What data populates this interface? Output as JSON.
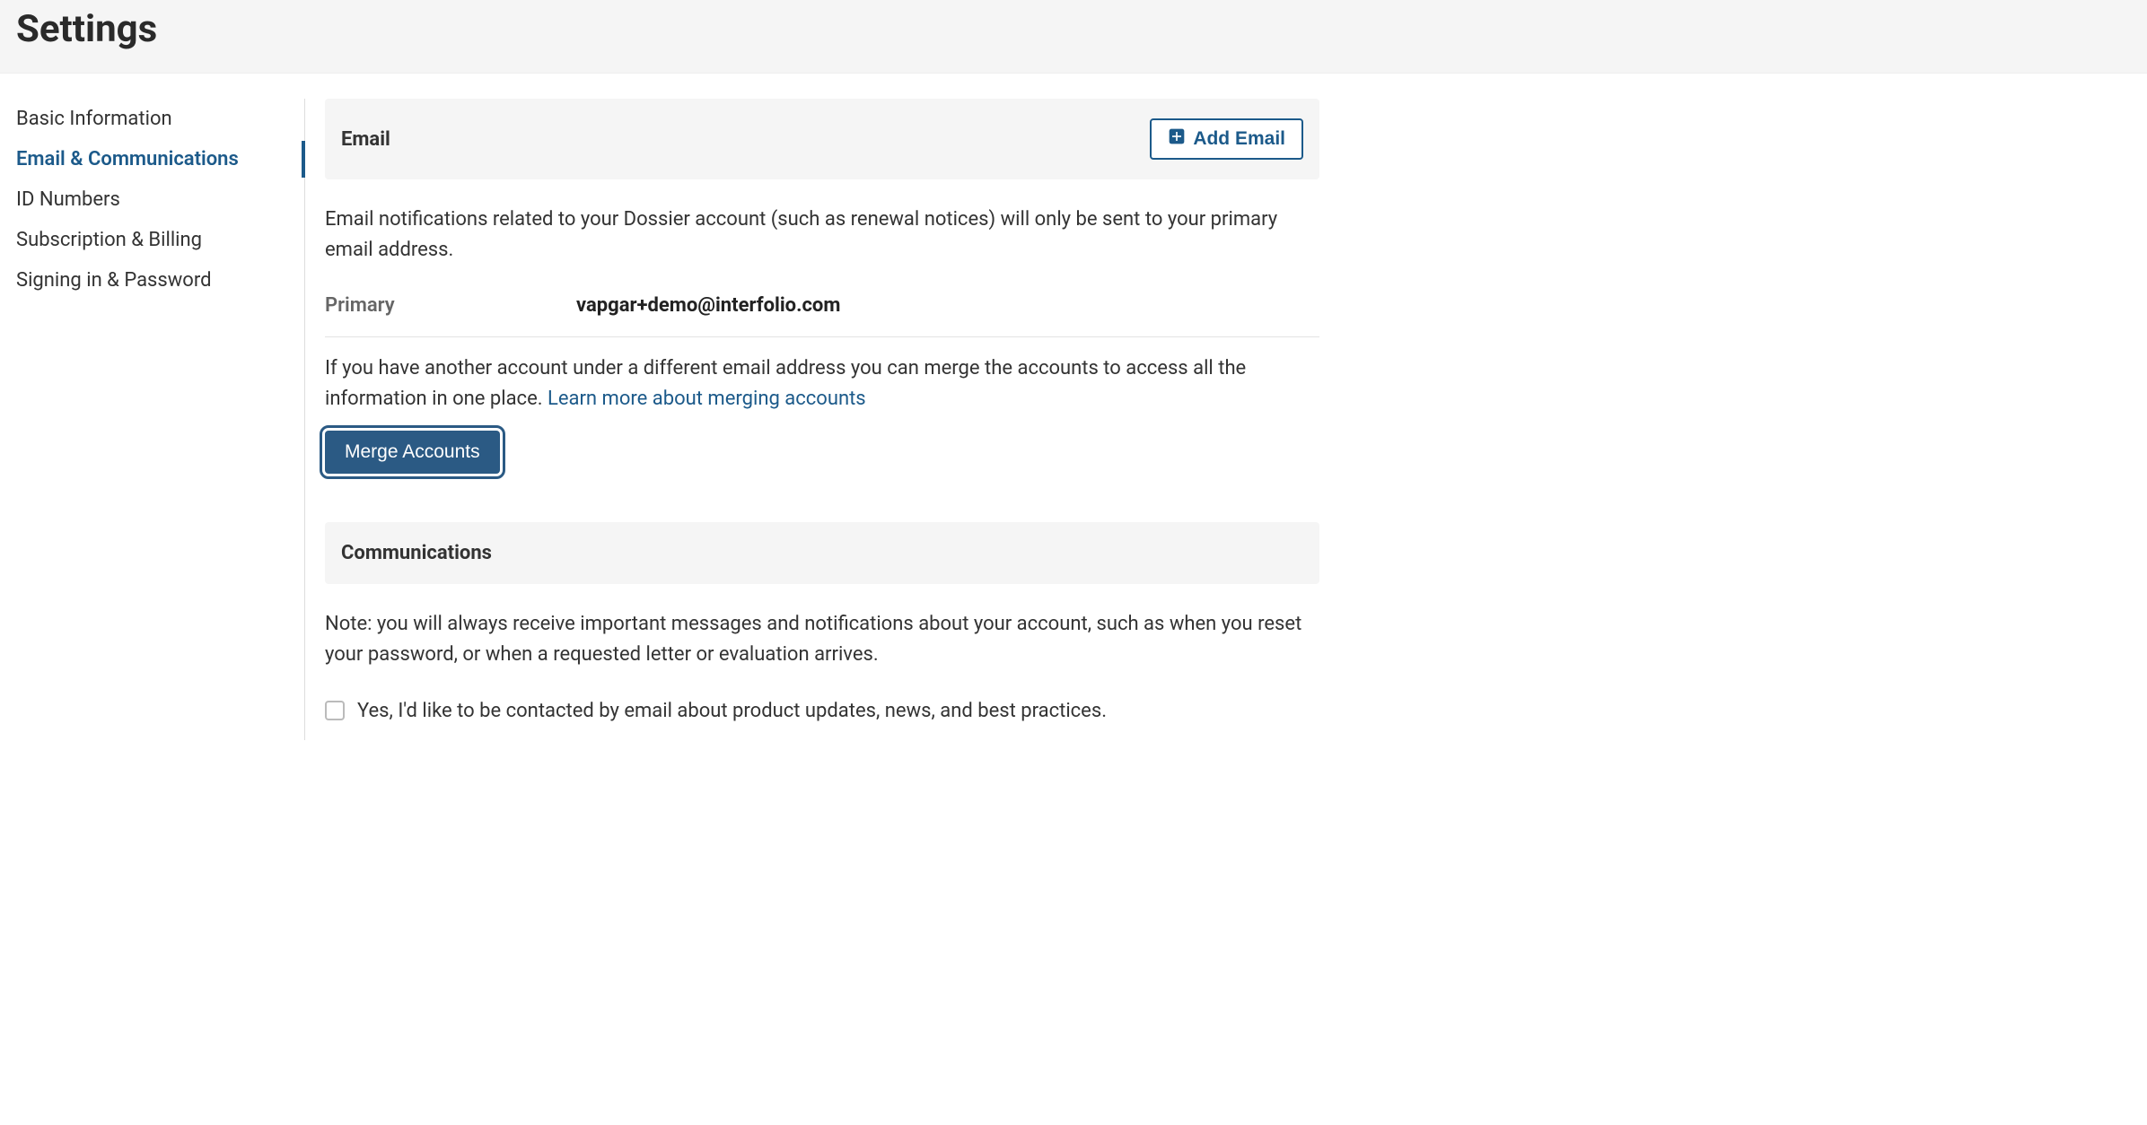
{
  "header": {
    "title": "Settings"
  },
  "sidebar": {
    "items": [
      {
        "label": "Basic Information",
        "active": false
      },
      {
        "label": "Email & Communications",
        "active": true
      },
      {
        "label": "ID Numbers",
        "active": false
      },
      {
        "label": "Subscription & Billing",
        "active": false
      },
      {
        "label": "Signing in & Password",
        "active": false
      }
    ]
  },
  "email_section": {
    "heading": "Email",
    "add_button_label": "Add Email",
    "description": "Email notifications related to your Dossier account (such as renewal notices) will only be sent to your primary email address.",
    "primary_label": "Primary",
    "primary_email": "vapgar+demo@interfolio.com",
    "merge_text_before": "If you have another account under a different email address you can merge the accounts to access all the information in one place. ",
    "merge_link_label": "Learn more about merging accounts",
    "merge_button_label": "Merge Accounts"
  },
  "communications_section": {
    "heading": "Communications",
    "note": "Note: you will always receive important messages and notifications about your account, such as when you reset your password, or when a requested letter or evaluation arrives.",
    "opt_in_label": "Yes, I'd like to be contacted by email about product updates, news, and best practices.",
    "opt_in_checked": false
  }
}
